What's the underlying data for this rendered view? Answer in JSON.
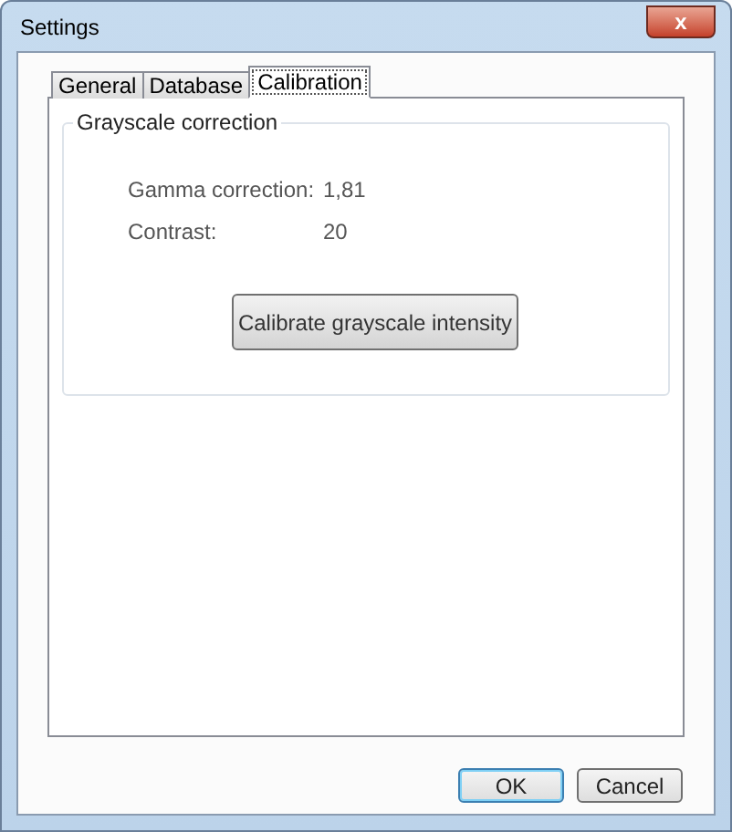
{
  "window": {
    "title": "Settings",
    "close": "x"
  },
  "tabs": [
    {
      "label": "General",
      "selected": false
    },
    {
      "label": "Database",
      "selected": false
    },
    {
      "label": "Calibration",
      "selected": true
    }
  ],
  "group": {
    "title": "Grayscale correction",
    "fields": [
      {
        "label": "Gamma correction:",
        "value": "1,81"
      },
      {
        "label": "Contrast:",
        "value": "20"
      }
    ],
    "button": "Calibrate grayscale intensity"
  },
  "buttons": [
    {
      "label": "OK",
      "default": true
    },
    {
      "label": "Cancel",
      "default": false
    }
  ]
}
